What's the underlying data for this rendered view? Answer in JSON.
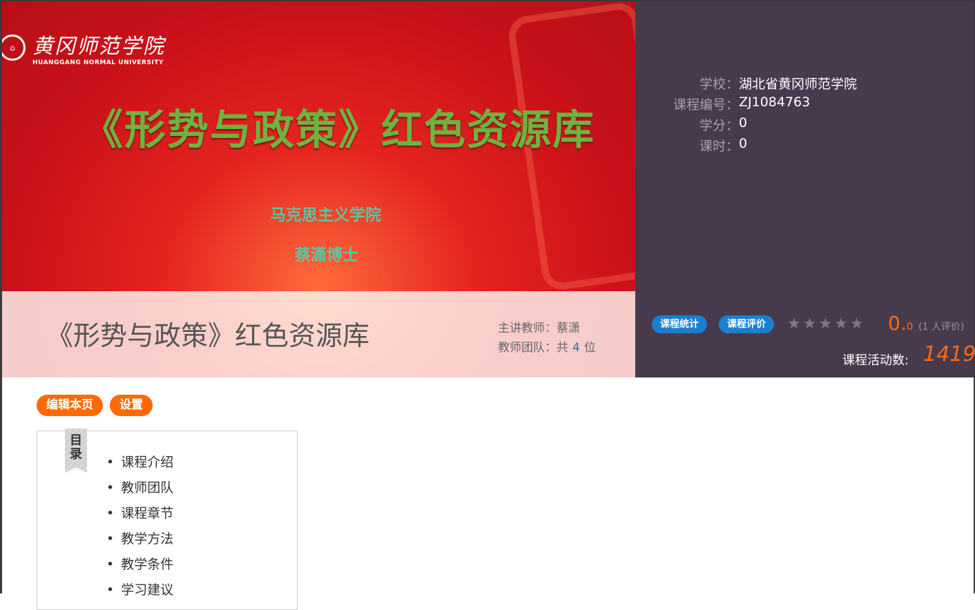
{
  "banner": {
    "logo_cn": "黄冈师范学院",
    "logo_en": "HUANGGANG NORMAL UNIVERSITY",
    "title": "《形势与政策》红色资源库",
    "subtitle1": "马克思主义学院",
    "subtitle2": "蔡潇博士"
  },
  "course": {
    "title": "《形势与政策》红色资源库",
    "teacher_label": "主讲教师：",
    "teacher": "蔡潇",
    "team_label": "教师团队：共",
    "team_count": "4",
    "team_unit": "位"
  },
  "info": [
    {
      "k": "学校：",
      "v": "湖北省黄冈师范学院"
    },
    {
      "k": "课程编号：",
      "v": "ZJ1084763"
    },
    {
      "k": "学分：",
      "v": "0"
    },
    {
      "k": "课时：",
      "v": "0"
    }
  ],
  "stats": {
    "btn_stats": "课程统计",
    "btn_review": "课程评价",
    "stars": "★★★★★",
    "rating": 0,
    "score_int": "0.",
    "score_dec": "0",
    "review_count": "(1 人评价)",
    "activity_label": "课程活动数:",
    "activity": "1419"
  },
  "toolbar": {
    "edit": "编辑本页",
    "settings": "设置"
  },
  "toc": {
    "label": "目录",
    "items": [
      "课程介绍",
      "教师团队",
      "课程章节",
      "教学方法",
      "教学条件",
      "学习建议"
    ]
  },
  "colors": {
    "accent": "#ff6a00",
    "blue": "#1a7fd1",
    "panel": "#473a4d"
  }
}
